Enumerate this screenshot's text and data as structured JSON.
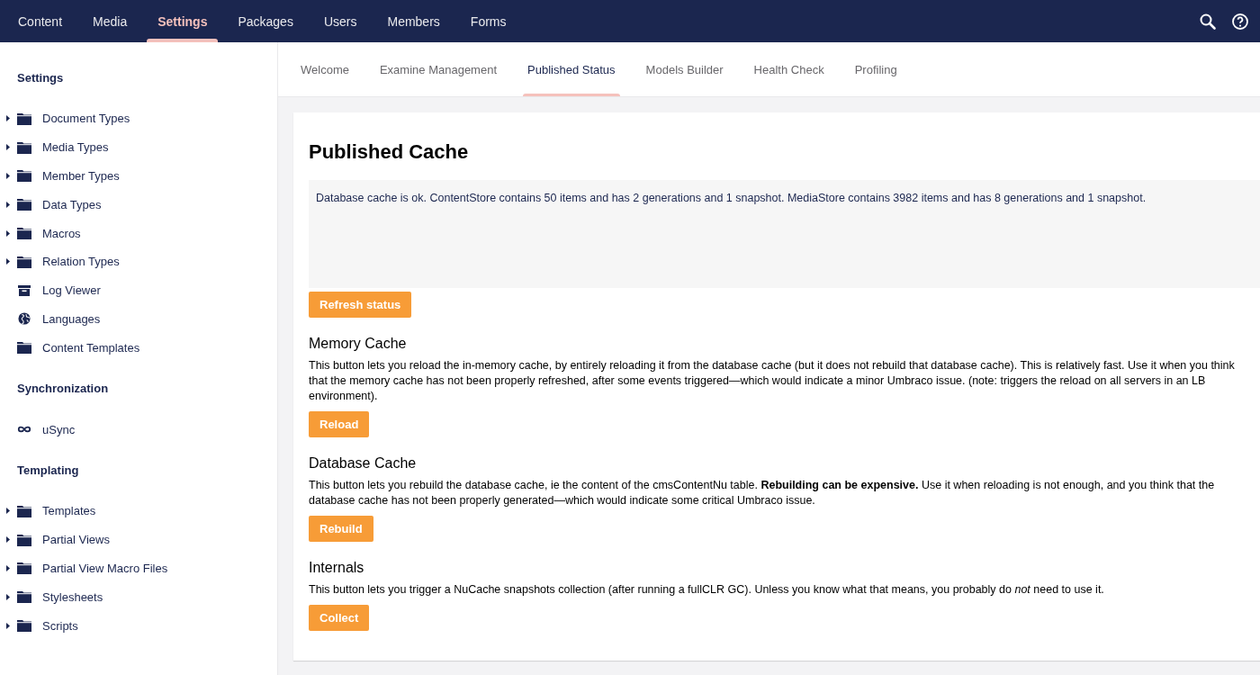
{
  "top_nav": {
    "sections": [
      {
        "label": "Content",
        "selected": false
      },
      {
        "label": "Media",
        "selected": false
      },
      {
        "label": "Settings",
        "selected": true
      },
      {
        "label": "Packages",
        "selected": false
      },
      {
        "label": "Users",
        "selected": false
      },
      {
        "label": "Members",
        "selected": false
      },
      {
        "label": "Forms",
        "selected": false
      }
    ]
  },
  "sidebar": {
    "groups": [
      {
        "title": "Settings",
        "items": [
          {
            "label": "Document Types",
            "kind": "folder",
            "expandable": true
          },
          {
            "label": "Media Types",
            "kind": "folder",
            "expandable": true
          },
          {
            "label": "Member Types",
            "kind": "folder",
            "expandable": true
          },
          {
            "label": "Data Types",
            "kind": "folder",
            "expandable": true
          },
          {
            "label": "Macros",
            "kind": "folder",
            "expandable": true
          },
          {
            "label": "Relation Types",
            "kind": "folder",
            "expandable": true
          },
          {
            "label": "Log Viewer",
            "kind": "archive",
            "expandable": false
          },
          {
            "label": "Languages",
            "kind": "globe",
            "expandable": false
          },
          {
            "label": "Content Templates",
            "kind": "folder",
            "expandable": false
          }
        ]
      },
      {
        "title": "Synchronization",
        "items": [
          {
            "label": "uSync",
            "kind": "infinity",
            "expandable": false
          }
        ]
      },
      {
        "title": "Templating",
        "items": [
          {
            "label": "Templates",
            "kind": "folder",
            "expandable": true
          },
          {
            "label": "Partial Views",
            "kind": "folder",
            "expandable": true
          },
          {
            "label": "Partial View Macro Files",
            "kind": "folder",
            "expandable": true
          },
          {
            "label": "Stylesheets",
            "kind": "folder",
            "expandable": true
          },
          {
            "label": "Scripts",
            "kind": "folder",
            "expandable": true
          }
        ]
      }
    ]
  },
  "tabs": [
    {
      "label": "Welcome",
      "selected": false
    },
    {
      "label": "Examine Management",
      "selected": false
    },
    {
      "label": "Published Status",
      "selected": true
    },
    {
      "label": "Models Builder",
      "selected": false
    },
    {
      "label": "Health Check",
      "selected": false
    },
    {
      "label": "Profiling",
      "selected": false
    }
  ],
  "panel": {
    "title": "Published Cache",
    "status": "Database cache is ok. ContentStore contains 50 items and has 2 generations and 1 snapshot. MediaStore contains 3982 items and has 8 generations and 1 snapshot.",
    "status_button": "Refresh status",
    "sections": [
      {
        "heading": "Memory Cache",
        "text": "This button lets you reload the in-memory cache, by entirely reloading it from the database cache (but it does not rebuild that database cache). This is relatively fast. Use it when you think that the memory cache has not been properly refreshed, after some events triggered—which would indicate a minor Umbraco issue. (note: triggers the reload on all servers in an LB environment).",
        "button": "Reload"
      },
      {
        "heading": "Database Cache",
        "text": "This button lets you rebuild the database cache, ie the content of the cmsContentNu table. **Rebuilding can be expensive.** Use it when reloading is not enough, and you think that the database cache has not been properly generated—which would indicate some critical Umbraco issue.",
        "button": "Rebuild"
      },
      {
        "heading": "Internals",
        "text": "This button lets you trigger a NuCache snapshots collection (after running a fullCLR GC). Unless you know what that means, you probably do *not* need to use it.",
        "button": "Collect"
      }
    ]
  }
}
